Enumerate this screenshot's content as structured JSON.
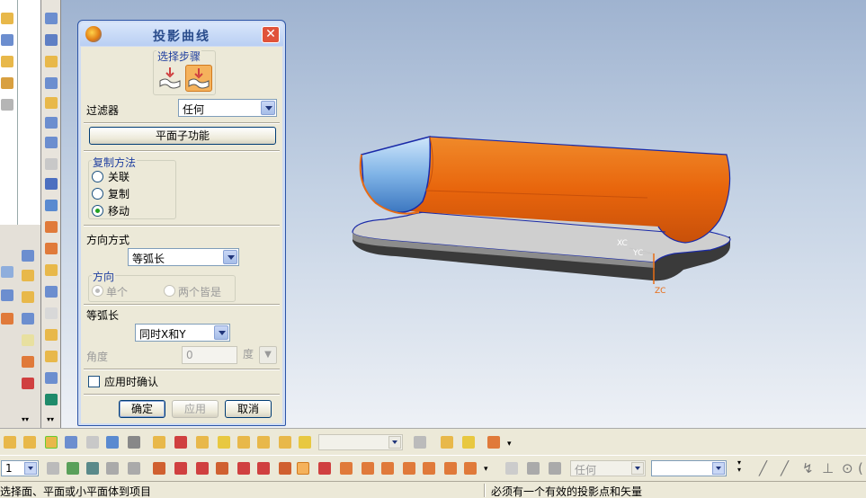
{
  "dialog": {
    "title": "投影曲线",
    "close_label": "✕",
    "select_steps_label": "选择步骤",
    "filter_label": "过滤器",
    "filter_value": "任何",
    "plane_subfunction_button": "平面子功能",
    "copy_method": {
      "label": "复制方法",
      "options": [
        "关联",
        "复制",
        "移动"
      ],
      "selected": "移动"
    },
    "direction_mode_label": "方向方式",
    "direction_mode_value": "等弧长",
    "direction": {
      "label": "方向",
      "options": [
        "单个",
        "两个皆是"
      ],
      "selected": "单个"
    },
    "arc_length_label": "等弧长",
    "arc_length_value": "同时X和Y",
    "angle_label": "角度",
    "angle_value": "0",
    "angle_unit": "度",
    "confirm_on_apply_label": "应用时确认",
    "ok_button": "确定",
    "apply_button": "应用",
    "cancel_button": "取消"
  },
  "viewport": {
    "axis_labels": {
      "xc": "XC",
      "yc": "YC",
      "zc": "ZC"
    },
    "colors": {
      "surface": "#e86c14",
      "edge": "#1a2aa8",
      "base": "#3a3a3a"
    }
  },
  "toolbar": {
    "filter_combo_value": "任何",
    "layer_combo_value": "1"
  },
  "status": {
    "left_text": "选择面、平面或小平面体到项目",
    "right_text": "必须有一个有效的投影点和矢量"
  }
}
